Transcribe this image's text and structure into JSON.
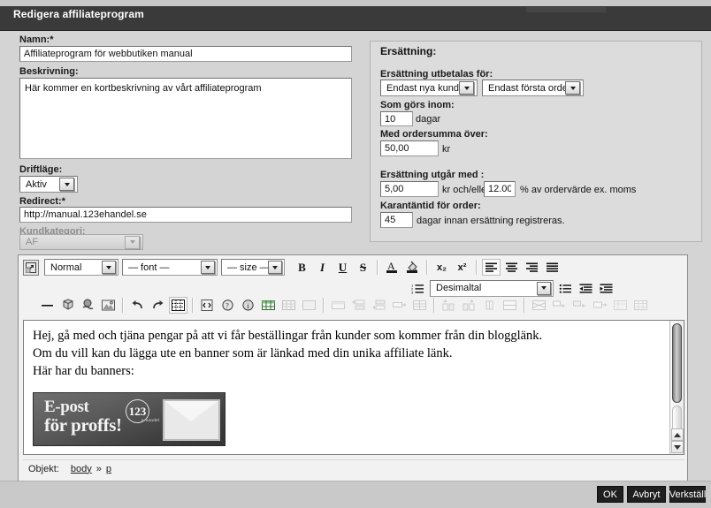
{
  "window": {
    "title": "Redigera affiliateprogram"
  },
  "form": {
    "name": {
      "label": "Namn:*",
      "value": "Affiliateprogram för webbutiken manual"
    },
    "description": {
      "label": "Beskrivning:",
      "value": "Här kommer en kortbeskrivning av vårt affiliateprogram"
    },
    "mode": {
      "label": "Driftläge:",
      "value": "Aktiv"
    },
    "redirect": {
      "label": "Redirect:*",
      "value": "http://manual.123ehandel.se"
    },
    "customer_category": {
      "label": "Kundkategori:",
      "value": "AF",
      "disabled": true
    }
  },
  "compensation": {
    "title": "Ersättning:",
    "paid_for_label": "Ersättning utbetalas för:",
    "paid_for_value": "Endast nya kunder",
    "order_scope_value": "Endast första order",
    "within_label": "Som görs inom:",
    "within_value": "10",
    "within_unit": "dagar",
    "order_sum_label": "Med ordersumma över:",
    "order_sum_value": "50,00",
    "order_sum_unit": "kr",
    "rate_label": "Ersättning utgår med :",
    "rate_amount_value": "5,00",
    "rate_amount_unit": "kr och/eller",
    "rate_percent_value": "12.00",
    "rate_percent_unit": "% av ordervärde ex. moms",
    "quarantine_label": "Karantäntid för order:",
    "quarantine_value": "45",
    "quarantine_unit": "dagar innan ersättning registreras."
  },
  "editor": {
    "toolbar": {
      "popup_icon": "popup-expand-icon",
      "block_format": "Normal",
      "font_family": "— font —",
      "font_size": "— size —",
      "bold": "B",
      "italic": "I",
      "underline": "U",
      "strike": "S",
      "forecolor_icon": "text-color-icon",
      "backcolor_icon": "background-color-icon",
      "subscript": "x₂",
      "superscript": "x²",
      "align_left_icon": "align-left-icon",
      "align_center_icon": "align-center-icon",
      "align_right_icon": "align-right-icon",
      "align_justify_icon": "align-justify-icon",
      "ordered_list_icon": "ordered-list-icon",
      "list_type": "Desimaltal",
      "unordered_list_icon": "unordered-list-icon",
      "outdent_icon": "outdent-icon",
      "indent_icon": "indent-icon",
      "hr_icon": "horizontal-rule-icon",
      "anchor_icon": "anchor-icon",
      "link_icon": "insert-link-icon",
      "image_icon": "insert-image-icon",
      "undo_icon": "undo-icon",
      "redo_icon": "redo-icon",
      "visualaid_icon": "visual-aid-icon",
      "source_icon": "html-source-icon",
      "help_icon": "help-icon",
      "about_icon": "about-icon",
      "table_icon": "insert-table-icon",
      "table_props_icon": "table-properties-icon",
      "cell_props_icon": "cell-properties-icon",
      "row_props_icon": "row-properties-icon",
      "row_before_icon": "insert-row-before-icon",
      "row_after_icon": "insert-row-after-icon",
      "delete_row_icon": "delete-row-icon",
      "split_cells_icon": "split-cells-icon",
      "col_before_icon": "insert-column-before-icon",
      "col_after_icon": "insert-column-after-icon",
      "delete_col_icon": "delete-column-icon",
      "merge_cells_icon": "merge-cells-icon",
      "cut_row_icon": "cut-row-icon",
      "copy_row_icon": "copy-row-icon",
      "paste_row_before_icon": "paste-row-before-icon",
      "paste_row_after_icon": "paste-row-after-icon",
      "table_extra1_icon": "table-extra-one-icon",
      "table_extra2_icon": "table-extra-two-icon"
    },
    "content": {
      "line1": "Hej, gå med och tjäna pengar på att vi får beställingar från kunder som kommer från din blogglänk.",
      "line2": "Om du vill kan du lägga ute en banner som är länkad med din unika affiliate länk.",
      "line3": "Här har du banners:",
      "banner": {
        "line1": "E-post",
        "line2": "för proffs!",
        "logo_number": "123",
        "logo_text": "e-handel",
        "envelope_icon": "envelope-icon"
      }
    },
    "status": {
      "label": "Objekt:",
      "path": [
        "body",
        "p"
      ],
      "separator": "»"
    }
  },
  "footer": {
    "ok": "OK",
    "cancel": "Avbryt",
    "apply": "Verkställ"
  },
  "colors": {
    "titlebar": "#3a3a3a",
    "page_bg": "#d4d4d4",
    "panel_bg": "#dcdcdc",
    "button_bg": "#1f1f1f"
  }
}
